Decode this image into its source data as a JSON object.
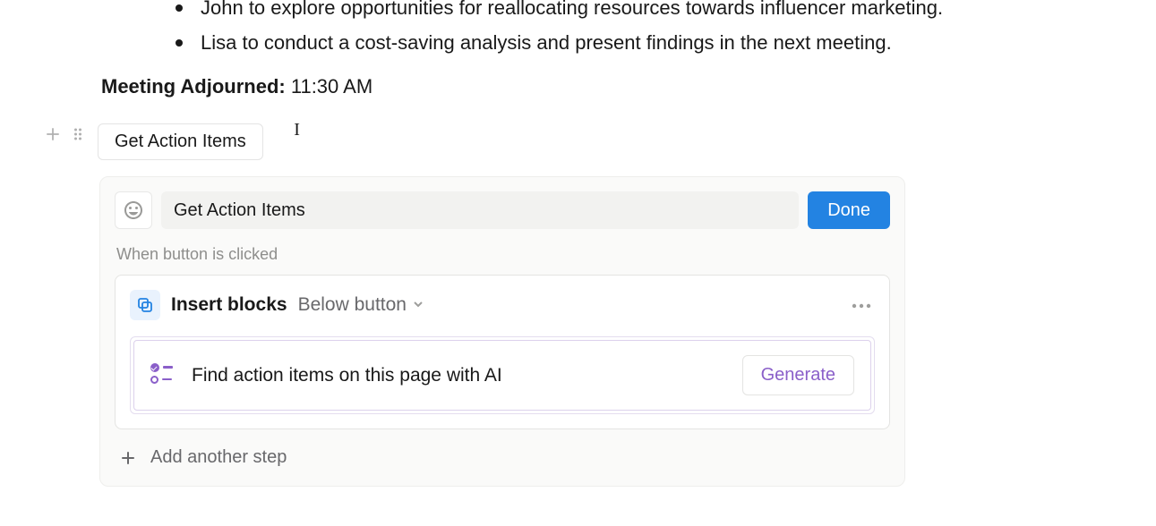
{
  "bullets": [
    "John to explore opportunities for reallocating resources towards influencer marketing.",
    "Lisa to conduct a cost-saving analysis and present findings in the next meeting."
  ],
  "meta": {
    "adjourned_label": "Meeting Adjourned:",
    "adjourned_time": "11:30 AM"
  },
  "button_block": {
    "label": "Get Action Items"
  },
  "config": {
    "title_value": "Get Action Items",
    "done_label": "Done",
    "when_clicked_label": "When button is clicked",
    "action": {
      "title": "Insert blocks",
      "position": "Below button"
    },
    "ai": {
      "prompt": "Find action items on this page with AI",
      "generate_label": "Generate"
    },
    "add_step_label": "Add another step"
  }
}
